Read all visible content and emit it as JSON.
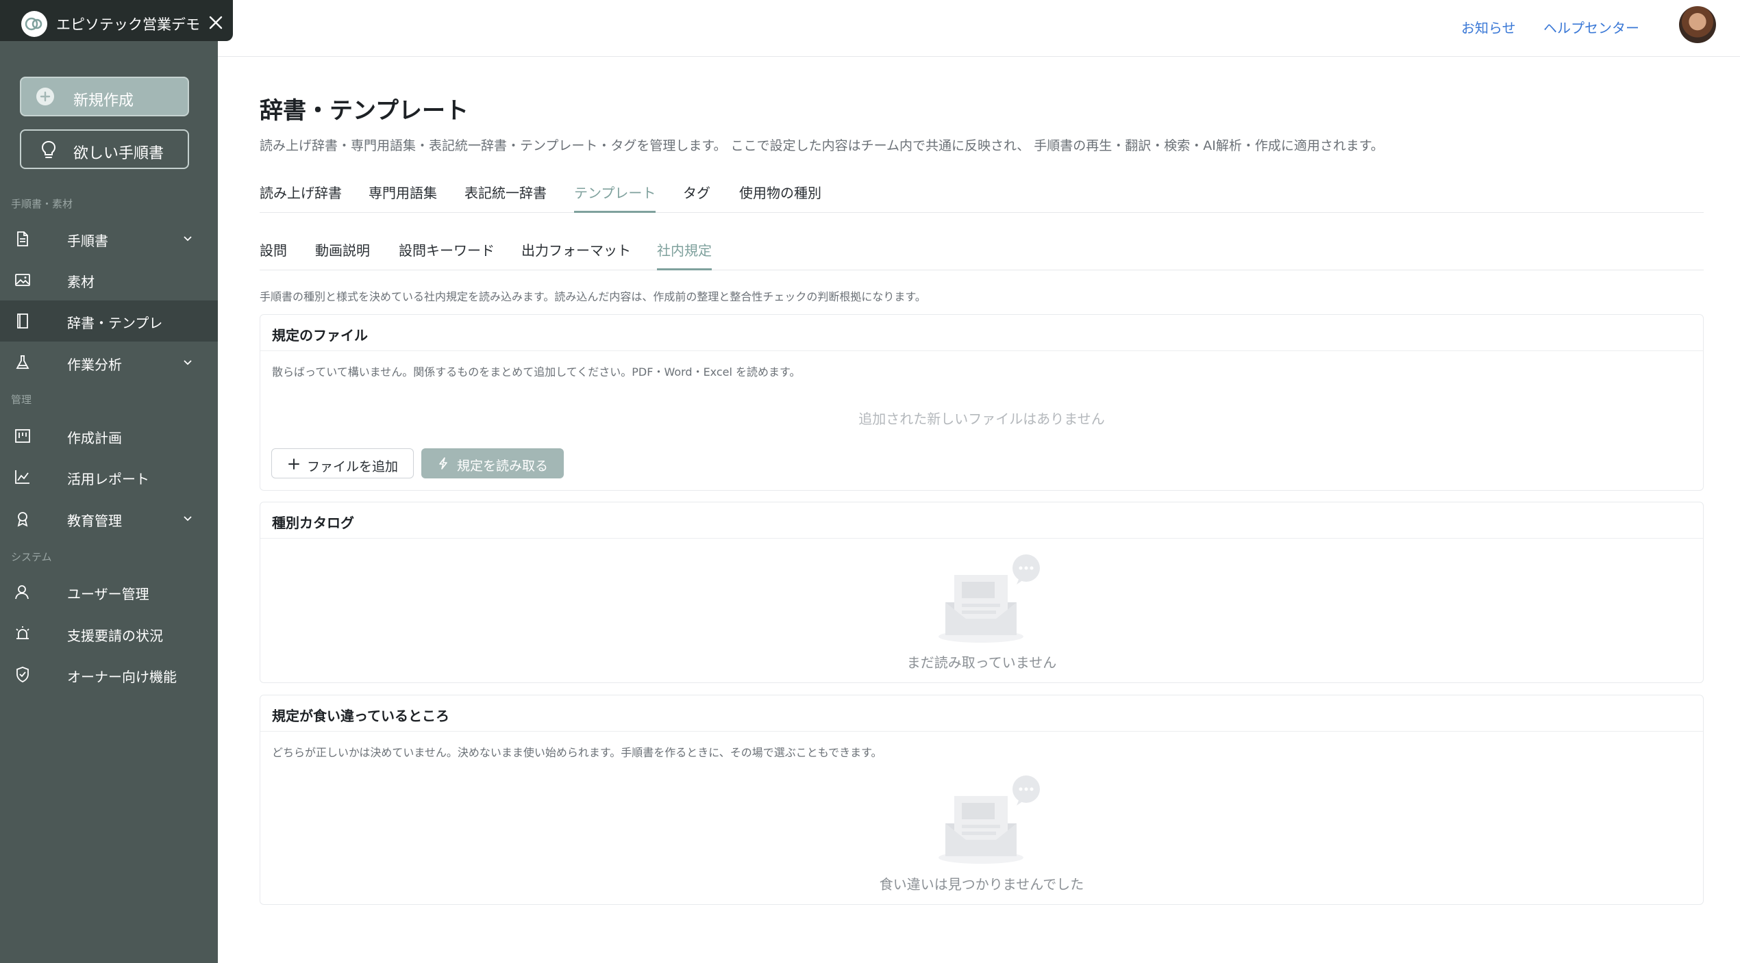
{
  "sidebar": {
    "brand": "エピソテック営業デモ",
    "new_button": "新規作成",
    "wish_button": "欲しい手順書",
    "sections": {
      "materials": "手順書・素材",
      "management": "管理",
      "system": "システム"
    },
    "items": [
      {
        "label": "手順書",
        "icon": "document-icon",
        "has_chevron": true
      },
      {
        "label": "素材",
        "icon": "image-icon",
        "has_chevron": false
      },
      {
        "label": "辞書・テンプレ",
        "icon": "book-icon",
        "has_chevron": false,
        "active": true
      },
      {
        "label": "作業分析",
        "icon": "flask-icon",
        "has_chevron": true
      },
      {
        "label": "作成計画",
        "icon": "kanban-icon",
        "has_chevron": false
      },
      {
        "label": "活用レポート",
        "icon": "chart-line-icon",
        "has_chevron": false
      },
      {
        "label": "教育管理",
        "icon": "award-icon",
        "has_chevron": true
      },
      {
        "label": "ユーザー管理",
        "icon": "user-icon",
        "has_chevron": false
      },
      {
        "label": "支援要請の状況",
        "icon": "alarm-icon",
        "has_chevron": false
      },
      {
        "label": "オーナー向け機能",
        "icon": "shield-check-icon",
        "has_chevron": false
      }
    ]
  },
  "header": {
    "notice": "お知らせ",
    "help": "ヘルプセンター"
  },
  "main": {
    "title": "辞書・テンプレート",
    "description": "読み上げ辞書・専門用語集・表記統一辞書・テンプレート・タグを管理します。 ここで設定した内容はチーム内で共通に反映され、 手順書の再生・翻訳・検索・AI解析・作成に適用されます。",
    "tabs": [
      "読み上げ辞書",
      "専門用語集",
      "表記統一辞書",
      "テンプレート",
      "タグ",
      "使用物の種別"
    ],
    "active_tab": "テンプレート",
    "subtabs": [
      "設問",
      "動画説明",
      "設問キーワード",
      "出力フォーマット",
      "社内規定"
    ],
    "active_subtab": "社内規定",
    "info": "手順書の種別と様式を決めている社内規定を読み込みます。読み込んだ内容は、作成前の整理と整合性チェックの判断根拠になります。",
    "files_card": {
      "title": "規定のファイル",
      "note": "散らばっていて構いません。関係するものをまとめて追加してください。PDF・Word・Excel を読めます。",
      "empty": "追加された新しいファイルはありません",
      "add_button": "ファイルを追加",
      "read_button": "規定を読み取る"
    },
    "catalog_card": {
      "title": "種別カタログ",
      "empty": "まだ読み取っていません"
    },
    "conflict_card": {
      "title": "規定が食い違っているところ",
      "note": "どちらが正しいかは決めていません。決めないまま使い始められます。手順書を作るときに、その場で選ぶこともできます。",
      "empty": "食い違いは見つかりませんでした"
    }
  },
  "colors": {
    "sidebar_bg": "#4c5856",
    "accent": "#7fa19d",
    "link": "#3a78d6"
  }
}
